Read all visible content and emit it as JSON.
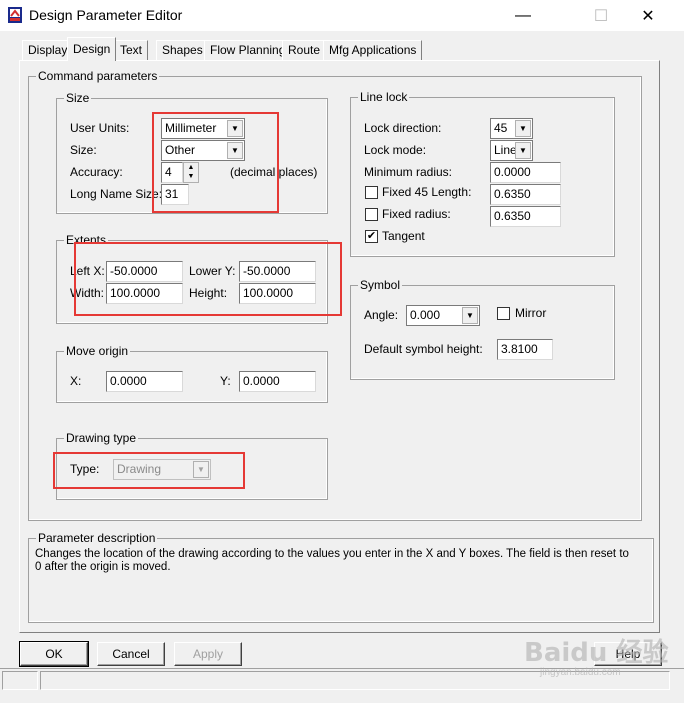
{
  "window": {
    "title": "Design Parameter Editor"
  },
  "caption_buttons": {
    "minimize": "—",
    "maximize": "☐",
    "close": "✕"
  },
  "tabs": [
    "Display",
    "Design",
    "Text",
    "Shapes",
    "Flow Planning",
    "Route",
    "Mfg Applications"
  ],
  "active_tab": "Design",
  "command_parameters": {
    "legend": "Command parameters",
    "size": {
      "legend": "Size",
      "user_units_label": "User Units:",
      "user_units_value": "Millimeter",
      "size_label": "Size:",
      "size_value": "Other",
      "accuracy_label": "Accuracy:",
      "accuracy_value": "4",
      "accuracy_hint": "(decimal places)",
      "long_name_label": "Long Name Size:",
      "long_name_value": "31"
    },
    "extents": {
      "legend": "Extents",
      "left_x_label": "Left X:",
      "left_x_value": "-50.0000",
      "lower_y_label": "Lower Y:",
      "lower_y_value": "-50.0000",
      "width_label": "Width:",
      "width_value": "100.0000",
      "height_label": "Height:",
      "height_value": "100.0000"
    },
    "move_origin": {
      "legend": "Move origin",
      "x_label": "X:",
      "x_value": "0.0000",
      "y_label": "Y:",
      "y_value": "0.0000"
    },
    "drawing_type": {
      "legend": "Drawing type",
      "type_label": "Type:",
      "type_value": "Drawing"
    },
    "line_lock": {
      "legend": "Line lock",
      "lock_direction_label": "Lock direction:",
      "lock_direction_value": "45",
      "lock_mode_label": "Lock mode:",
      "lock_mode_value": "Line",
      "min_radius_label": "Minimum radius:",
      "min_radius_value": "0.0000",
      "fixed45_label": "Fixed 45 Length:",
      "fixed45_value": "0.6350",
      "fixed45_checked": false,
      "fixed_radius_label": "Fixed radius:",
      "fixed_radius_value": "0.6350",
      "fixed_radius_checked": false,
      "tangent_label": "Tangent",
      "tangent_checked": true
    },
    "symbol": {
      "legend": "Symbol",
      "angle_label": "Angle:",
      "angle_value": "0.000",
      "mirror_label": "Mirror",
      "mirror_checked": false,
      "default_height_label": "Default symbol height:",
      "default_height_value": "3.8100"
    }
  },
  "parameter_description": {
    "legend": "Parameter description",
    "text": "Changes the location of the drawing according to the values you enter in the X and Y boxes. The field is then reset to 0 after the origin is moved."
  },
  "buttons": {
    "ok": "OK",
    "cancel": "Cancel",
    "apply": "Apply",
    "help": "Help"
  },
  "watermark": {
    "main": "Baidu 经验",
    "sub": "jingyan.baidu.com"
  },
  "colors": {
    "highlight_box": "#e53935",
    "dialog_bg": "#f0f0f0"
  }
}
